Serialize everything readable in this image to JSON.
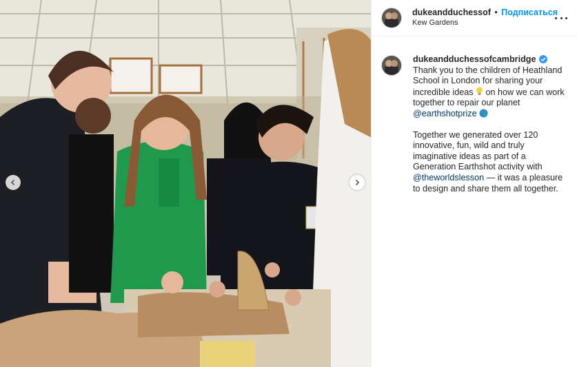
{
  "post": {
    "username_short": "dukeandduchessof",
    "separator": "•",
    "follow_label": "Подписаться",
    "location": "Kew Gardens",
    "more_icon": "more-horizontal-icon"
  },
  "caption": {
    "username": "dukeandduchessofcambridge",
    "p1_part1": "Thank you to the children of Heathland School in London for sharing your incredible ideas",
    "p1_part2": "on how we can work together to repair our planet",
    "mention1": "@earthshotprize",
    "p2_part1": "Together we generated over 120 innovative, fun, wild and truly imaginative ideas as part of a Generation Earthshot activity with",
    "mention2": "@theworldslesson",
    "p2_part2": "— it was a pleasure to design and share them all together."
  },
  "icons": {
    "left_nav": "chevron-left-icon",
    "right_nav": "chevron-right-icon",
    "verified": "verified-badge-icon",
    "bulb": "light-bulb-emoji-icon",
    "globe": "globe-emoji-icon"
  },
  "colors": {
    "follow": "#0095f6",
    "verified": "#3897f0",
    "mention": "#00376b"
  }
}
